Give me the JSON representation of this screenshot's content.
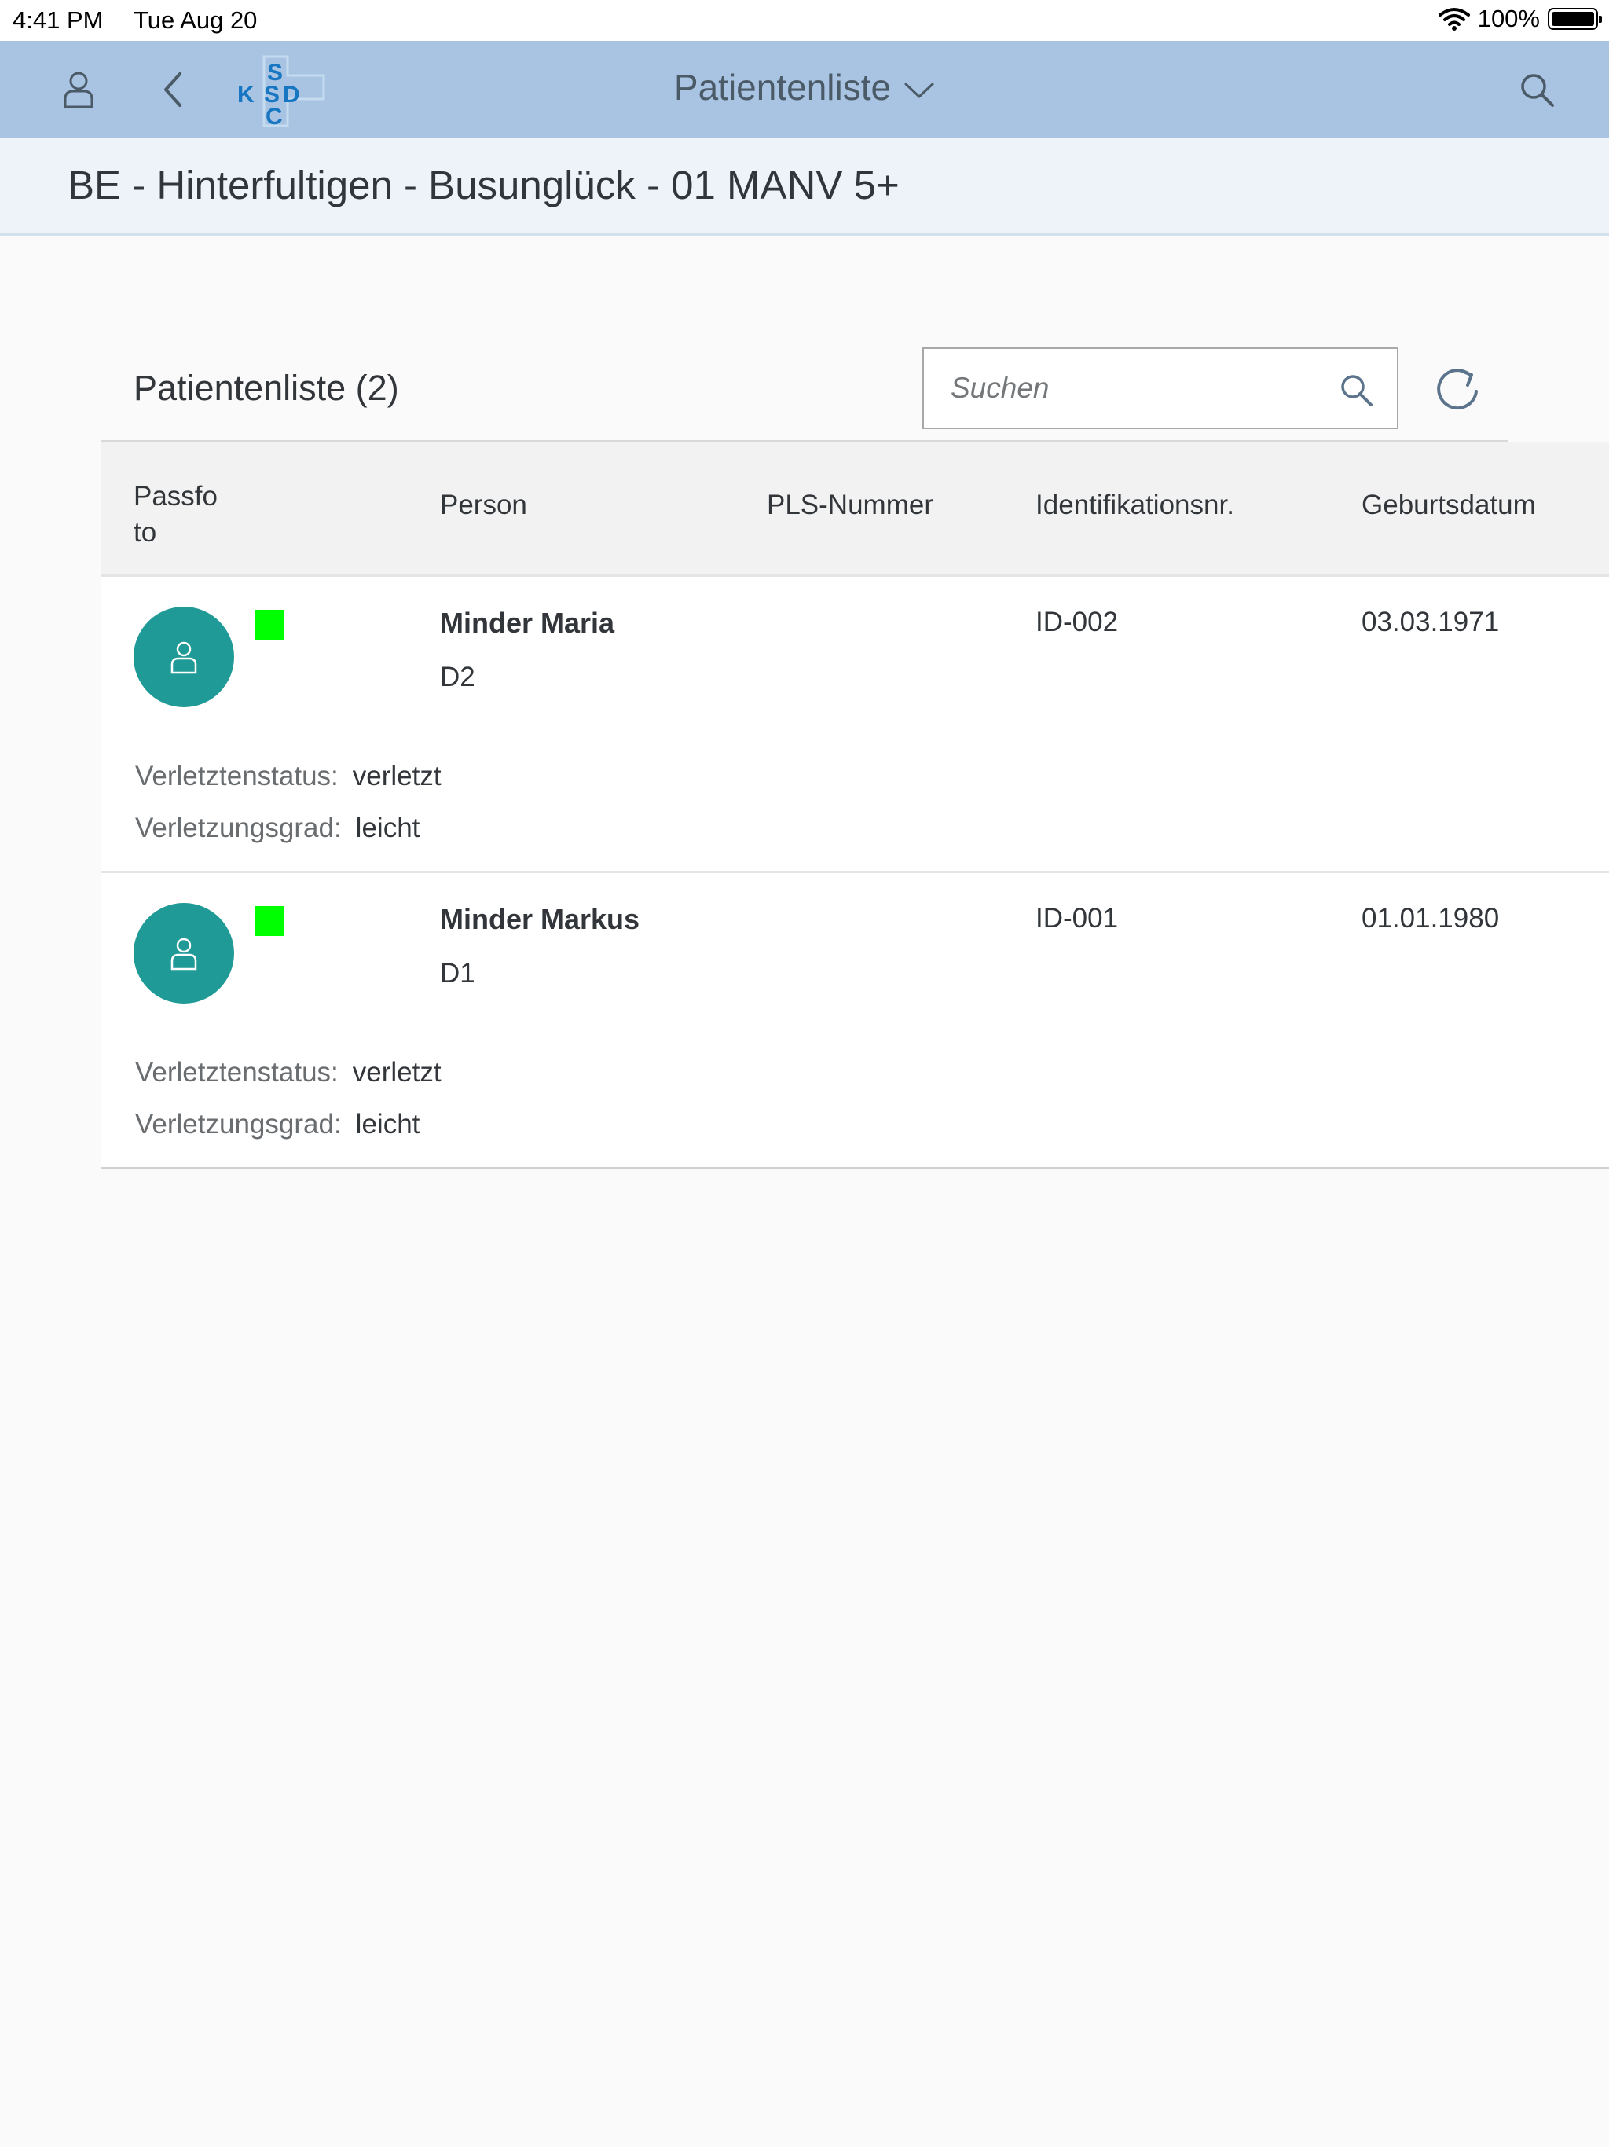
{
  "status_bar": {
    "time": "4:41 PM",
    "date": "Tue Aug 20",
    "battery": "100%"
  },
  "shell": {
    "title": "Patientenliste",
    "logo_text": "SKSDC"
  },
  "subheader": {
    "title": "BE - Hinterfultigen - Busunglück - 01 MANV 5+"
  },
  "list": {
    "title": "Patientenliste (2)",
    "search_placeholder": "Suchen",
    "columns": {
      "photo": "Passfo to",
      "person": "Person",
      "pls": "PLS-Nummer",
      "id": "Identifikationsnr.",
      "birth": "Geburtsdatum"
    },
    "attr_labels": {
      "status": "Verletztenstatus:",
      "grade": "Verletzungsgrad:"
    },
    "rows": [
      {
        "name": "Minder Maria",
        "code": "D2",
        "pls": "",
        "id": "ID-002",
        "birthdate": "03.03.1971",
        "injury_status": "verletzt",
        "injury_grade": "leicht",
        "triage_color": "#00ff00"
      },
      {
        "name": "Minder Markus",
        "code": "D1",
        "pls": "",
        "id": "ID-001",
        "birthdate": "01.01.1980",
        "injury_status": "verletzt",
        "injury_grade": "leicht",
        "triage_color": "#00ff00"
      }
    ]
  },
  "colors": {
    "shellbar": "#a9c4e2",
    "subheader": "#edf3f9",
    "avatar": "#1f9a96",
    "triage_green": "#00ff00"
  },
  "icons": {
    "user": "user-icon",
    "back": "chevron-left-icon",
    "search": "search-icon",
    "refresh": "refresh-icon",
    "dropdown": "chevron-down-icon",
    "avatar": "person-placeholder-icon"
  }
}
